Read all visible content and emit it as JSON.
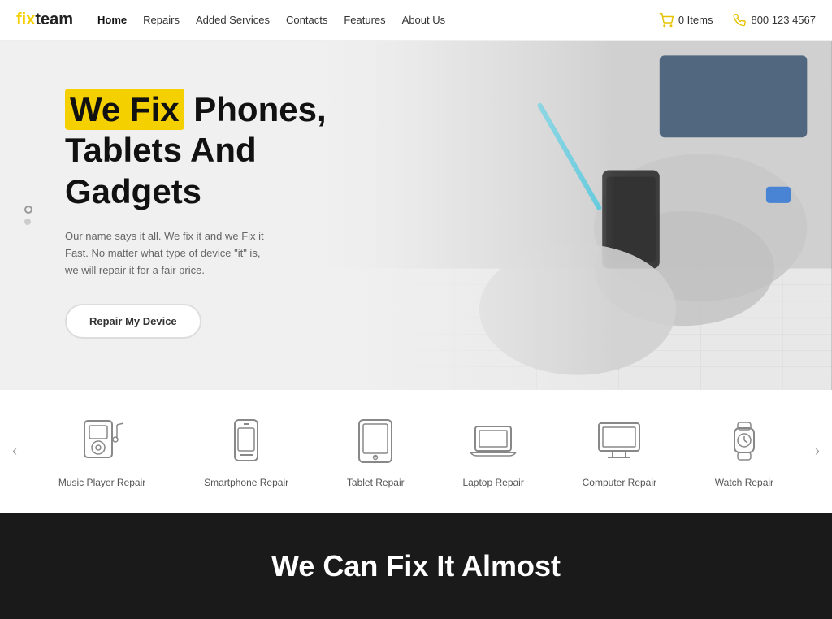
{
  "header": {
    "logo": {
      "fix": "fix",
      "team": "team"
    },
    "nav": {
      "items": [
        {
          "label": "Home",
          "active": true
        },
        {
          "label": "Repairs",
          "active": false
        },
        {
          "label": "Added Services",
          "active": false
        },
        {
          "label": "Contacts",
          "active": false
        },
        {
          "label": "Features",
          "active": false
        },
        {
          "label": "About Us",
          "active": false
        }
      ]
    },
    "cart": {
      "label": "0 Items"
    },
    "phone": {
      "number": "800 123 4567"
    }
  },
  "hero": {
    "title_highlight": "We Fix",
    "title_rest": " Phones,",
    "title_line2": "Tablets And",
    "title_line3": "Gadgets",
    "subtitle": "Our name says it all. We fix it and we Fix it Fast. No matter what type of device \"it\" is, we will repair it for a fair price.",
    "cta_button": "Repair My Device",
    "dots": [
      {
        "active": true
      },
      {
        "active": false
      }
    ]
  },
  "services": {
    "prev_arrow": "‹",
    "next_arrow": "›",
    "items": [
      {
        "label": "Music Player Repair",
        "icon": "music-player"
      },
      {
        "label": "Smartphone Repair",
        "icon": "smartphone"
      },
      {
        "label": "Tablet Repair",
        "icon": "tablet"
      },
      {
        "label": "Laptop Repair",
        "icon": "laptop"
      },
      {
        "label": "Computer Repair",
        "icon": "computer"
      },
      {
        "label": "Watch Repair",
        "icon": "watch"
      }
    ]
  },
  "bottom": {
    "title": "We Can Fix It Almost"
  }
}
